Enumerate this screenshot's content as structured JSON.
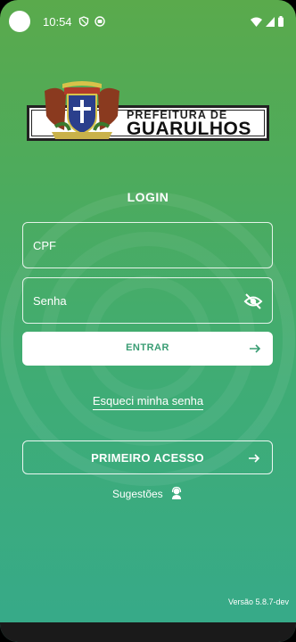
{
  "status_bar": {
    "time": "10:54"
  },
  "logo": {
    "line1": "PREFEITURA DE",
    "line2": "GUARULHOS"
  },
  "login": {
    "title": "LOGIN",
    "cpf_placeholder": "CPF",
    "senha_placeholder": "Senha",
    "entrar_label": "ENTRAR",
    "forgot_label": "Esqueci minha senha",
    "primeiro_acesso_label": "PRIMEIRO ACESSO",
    "sugestoes_label": "Sugestões"
  },
  "footer": {
    "version": "Versão 5.8.7-dev"
  },
  "colors": {
    "accent": "#3a9d74",
    "gradient_top": "#5aaa4c",
    "gradient_bottom": "#36aa8a"
  }
}
